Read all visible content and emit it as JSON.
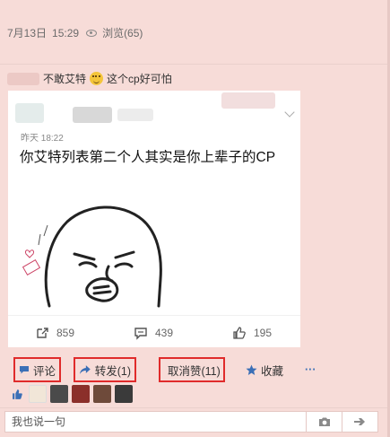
{
  "meta": {
    "date": "7月13日",
    "time": "15:29",
    "views_label": "浏览(65)"
  },
  "post": {
    "text_before": "不敢艾特",
    "text_after": "这个cp好可怕"
  },
  "card": {
    "time": "昨天 18:22",
    "title": "你艾特列表第二个人其实是你上辈子的CP",
    "stats": {
      "shares": "859",
      "comments": "439",
      "likes": "195"
    }
  },
  "actions": {
    "comment": "评论",
    "forward": "转发(1)",
    "unlike": "取消赞(11)",
    "favorite": "收藏",
    "more": "···"
  },
  "likers": {
    "avatar_colors": [
      "#f1e6d8",
      "#4a4a4a",
      "#8b2f2a",
      "#6e4a3a",
      "#3a3a3a"
    ]
  },
  "comment_box": {
    "placeholder": "我也说一句"
  },
  "colors": {
    "accent": "#e02b2b",
    "link_blue": "#3b6fb6",
    "background": "#f7dcd8"
  }
}
